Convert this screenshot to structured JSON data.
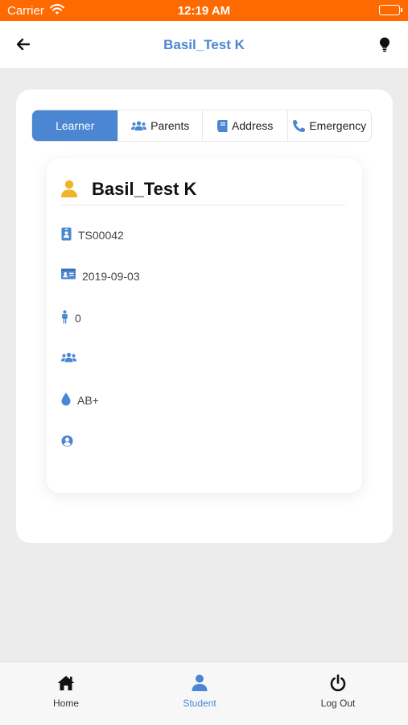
{
  "status_bar": {
    "carrier": "Carrier",
    "time": "12:19 AM",
    "battery_level": 1.0
  },
  "nav": {
    "title": "Basil_Test K",
    "back_icon": "arrow-left-icon",
    "action_icon": "lightbulb-icon"
  },
  "tabs": [
    {
      "label": "Learner",
      "icon": "",
      "active": true
    },
    {
      "label": "Parents",
      "icon": "users-icon",
      "active": false
    },
    {
      "label": "Address",
      "icon": "book-icon",
      "active": false
    },
    {
      "label": "Emergency",
      "icon": "phone-icon",
      "active": false
    }
  ],
  "learner": {
    "name": "Basil_Test K",
    "fields": [
      {
        "icon": "id-badge-icon",
        "value": "TS00042"
      },
      {
        "icon": "id-card-icon",
        "value": "2019-09-03"
      },
      {
        "icon": "child-icon",
        "value": "0"
      },
      {
        "icon": "users-icon",
        "value": ""
      },
      {
        "icon": "blood-drop-icon",
        "value": "AB+"
      },
      {
        "icon": "user-circle-icon",
        "value": ""
      }
    ]
  },
  "bottom_tabs": [
    {
      "label": "Home",
      "icon": "home-icon",
      "active": false
    },
    {
      "label": "Student",
      "icon": "user-icon",
      "active": true
    },
    {
      "label": "Log Out",
      "icon": "power-icon",
      "active": false
    }
  ],
  "colors": {
    "status_bar": "#ff6a00",
    "accent": "#4a86d2",
    "learner_icon": "#f0b429"
  }
}
